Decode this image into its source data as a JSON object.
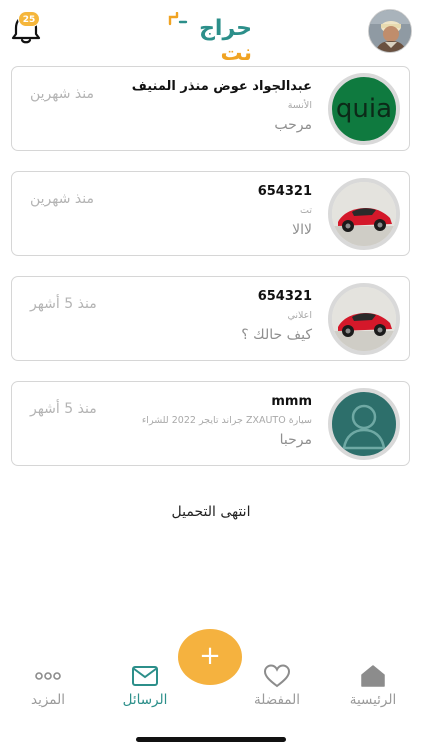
{
  "header": {
    "notification_count": "25",
    "logo": {
      "main": "حراج",
      "accent": "نت"
    }
  },
  "conversations": [
    {
      "name": "عبدالجواد عوض منذر المنيف",
      "subtitle": "الأنسة",
      "message": "مرحب",
      "time": "منذ شهرين",
      "thumb_text": "quia",
      "thumb_type": "text"
    },
    {
      "name": "654321",
      "subtitle": "تت",
      "message": "لاالا",
      "time": "منذ شهرين",
      "thumb_type": "car"
    },
    {
      "name": "654321",
      "subtitle": "اعلاني",
      "message": "كيف حالك ؟",
      "time": "منذ 5 أشهر",
      "thumb_type": "car"
    },
    {
      "name": "mmm",
      "subtitle": "سيارة ZXAUTO جراند تايجر 2022 للشراء",
      "message": "مرحبا",
      "time": "منذ 5 أشهر",
      "thumb_type": "person"
    }
  ],
  "end_text": "انتهى التحميل",
  "fab_label": "+",
  "nav": {
    "home": "الرئيسية",
    "favorites": "المفضلة",
    "messages": "الرسائل",
    "more": "المزيد"
  },
  "colors": {
    "accent": "#2c8f8a",
    "fab": "#f5b23f",
    "thumb_green": "#0f7a3f",
    "thumb_teal": "#2d6f6b"
  }
}
